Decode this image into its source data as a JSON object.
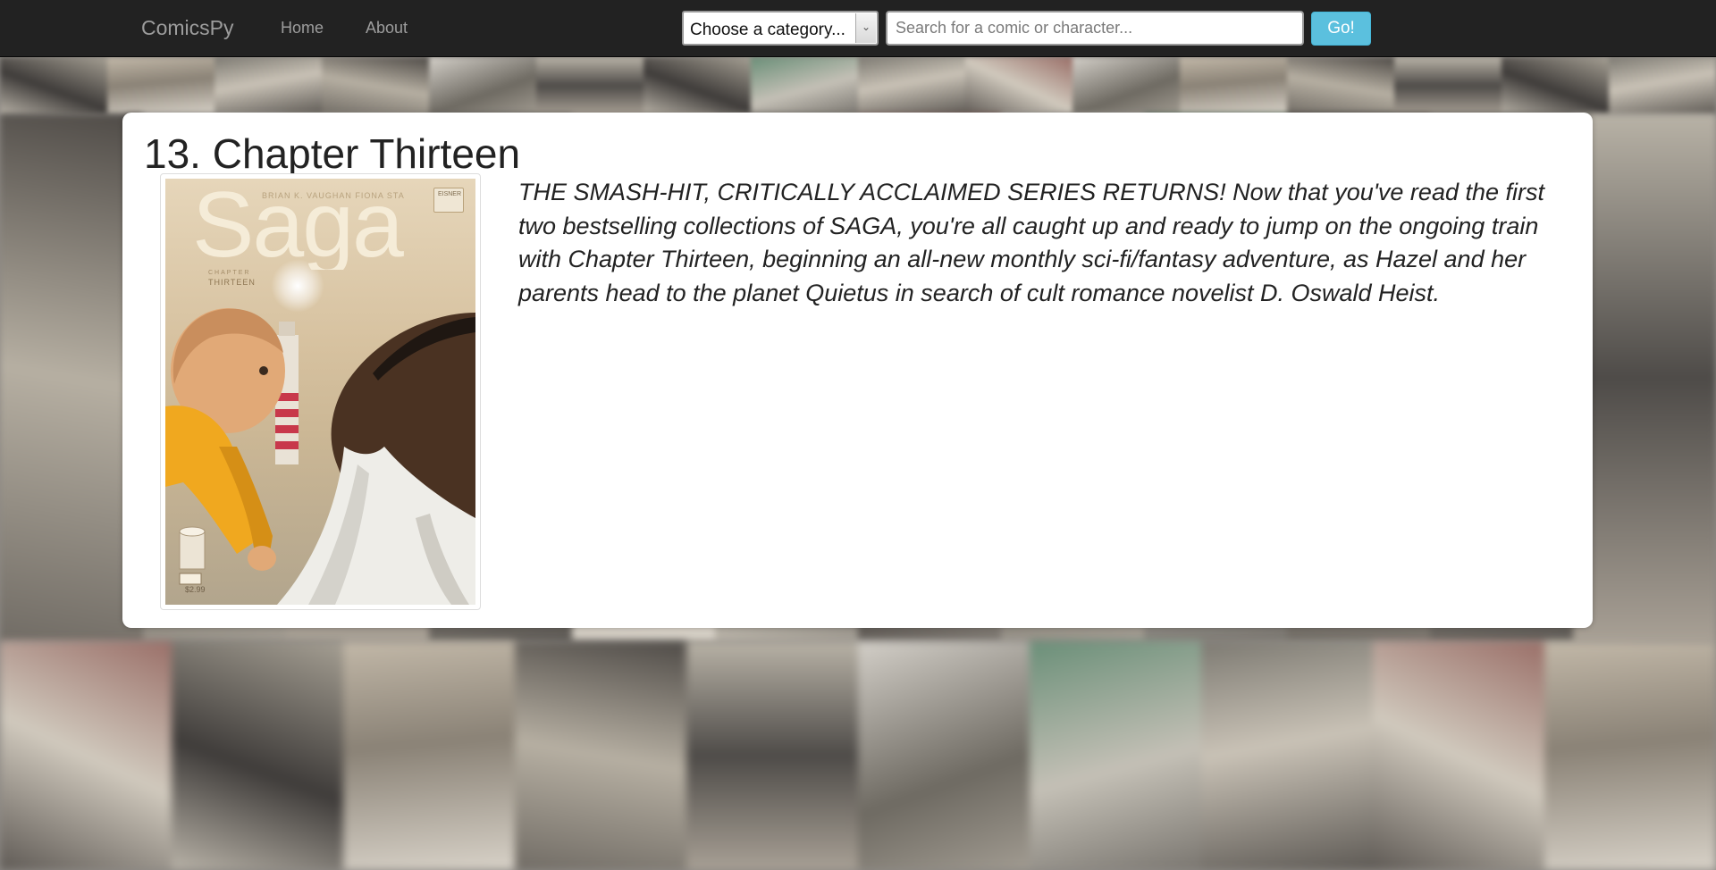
{
  "navbar": {
    "brand": "ComicsPy",
    "links": [
      {
        "label": "Home"
      },
      {
        "label": "About"
      }
    ],
    "category_select": {
      "selected": "Choose a category..."
    },
    "search": {
      "value": "",
      "placeholder": "Search for a comic or character..."
    },
    "go_label": "Go!",
    "go_color": "#5bc0de"
  },
  "issue": {
    "title": "13. Chapter Thirteen",
    "cover": {
      "series_logo": "Saga",
      "credits": "BRIAN K. VAUGHAN  FIONA STAPLES",
      "chapter_label": "CHAPTER",
      "chapter": "THIRTEEN",
      "badge": "EISNER",
      "price": "$2.99"
    },
    "description": "THE SMASH-HIT, CRITICALLY ACCLAIMED SERIES RETURNS! Now that you've read the first two bestselling collections of SAGA, you're all caught up and ready to jump on the ongoing train with Chapter Thirteen, beginning an all-new monthly sci-fi/fantasy adventure, as Hazel and her parents head to the planet Quietus in search of cult romance novelist D. Oswald Heist."
  }
}
